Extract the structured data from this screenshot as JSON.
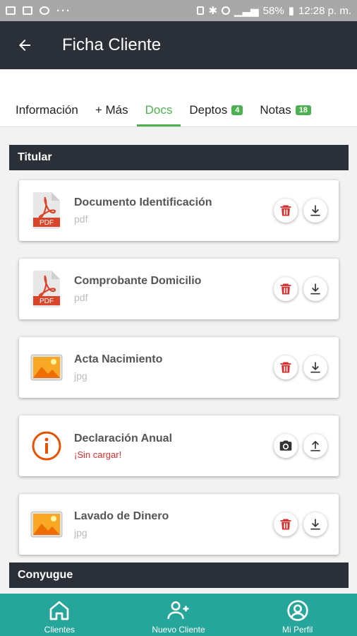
{
  "status_bar": {
    "dots": "···",
    "battery": "58%",
    "time": "12:28 p. m."
  },
  "appbar": {
    "title": "Ficha Cliente",
    "back_icon": "arrow-left-icon"
  },
  "tabs": [
    {
      "label": "Información"
    },
    {
      "label": "+ Más"
    },
    {
      "label": "Docs",
      "active": true
    },
    {
      "label": "Deptos",
      "badge": "4"
    },
    {
      "label": "Notas",
      "badge": "18"
    }
  ],
  "sections": {
    "titular": "Titular",
    "conyugue": "Conyugue"
  },
  "documents": [
    {
      "title": "Documento Identificación",
      "sub": "pdf",
      "icon": "pdf-icon",
      "actions": [
        "delete",
        "download"
      ]
    },
    {
      "title": "Comprobante Domicilio",
      "sub": "pdf",
      "icon": "pdf-icon",
      "actions": [
        "delete",
        "download"
      ]
    },
    {
      "title": "Acta Nacimiento",
      "sub": "jpg",
      "icon": "image-icon",
      "actions": [
        "delete",
        "download"
      ]
    },
    {
      "title": "Declaración Anual",
      "sub": "¡Sin cargar!",
      "icon": "info-icon",
      "actions": [
        "camera",
        "upload"
      ]
    },
    {
      "title": "Lavado de Dinero",
      "sub": "jpg",
      "icon": "image-icon",
      "actions": [
        "delete",
        "download"
      ]
    }
  ],
  "bottom_nav": [
    {
      "label": "Clientes",
      "icon": "home-icon"
    },
    {
      "label": "Nuevo Cliente",
      "icon": "add-user-icon"
    },
    {
      "label": "Mi Perfil",
      "icon": "profile-icon"
    }
  ],
  "colors": {
    "accent": "#4caf50",
    "appbar": "#2b3038",
    "bottom_nav": "#26a69a",
    "delete": "#d32f2f",
    "warning": "#e65100"
  }
}
